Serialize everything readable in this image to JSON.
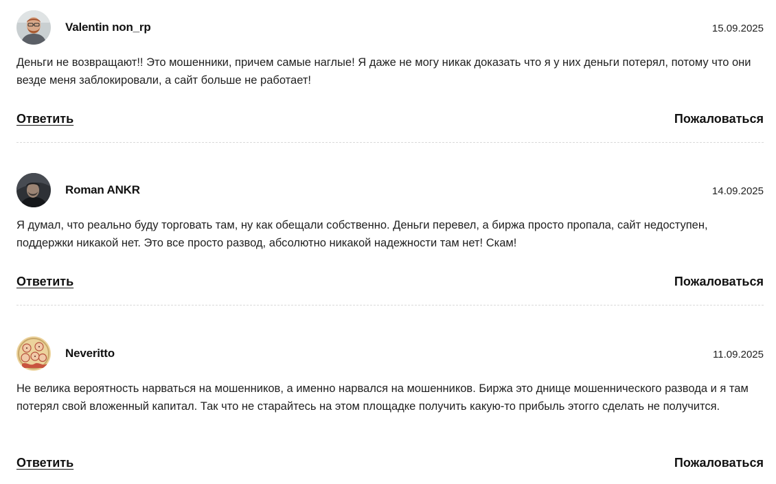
{
  "comments": [
    {
      "author": "Valentin non_rp",
      "date": "15.09.2025",
      "text": "Деньги не возвращают!! Это мошенники, причем самые наглые! Я даже не могу никак доказать что я у них деньги потерял, потому что они везде меня заблокировали, а сайт больше не работает!",
      "reply_label": "Ответить",
      "report_label": "Пожаловаться"
    },
    {
      "author": "Roman ANKR",
      "date": "14.09.2025",
      "text": "Я думал, что реально буду торговать там, ну как обещали собственно. Деньги перевел, а биржа просто пропала, сайт недоступен, поддержки никакой нет. Это все просто развод, абсолютно никакой надежности там нет! Скам!",
      "reply_label": "Ответить",
      "report_label": "Пожаловаться"
    },
    {
      "author": "Neveritto",
      "date": "11.09.2025",
      "text": "Не велика вероятность нарваться на мошенников, а именно нарвался на мошенников. Биржа это днище мошеннического развода и я там потерял свой вложенный капитал. Так что не старайтесь на этом площадке получить какую-то прибыль этогго сделать не получится.",
      "reply_label": "Ответить",
      "report_label": "Пожаловаться"
    }
  ],
  "avatars": [
    {
      "icon": "user-avatar-photo-icon",
      "bg": "#cfd4d6"
    },
    {
      "icon": "user-avatar-photo-icon",
      "bg": "#2b2e33"
    },
    {
      "icon": "user-avatar-illustration-icon",
      "bg": "#e9cf98"
    }
  ]
}
